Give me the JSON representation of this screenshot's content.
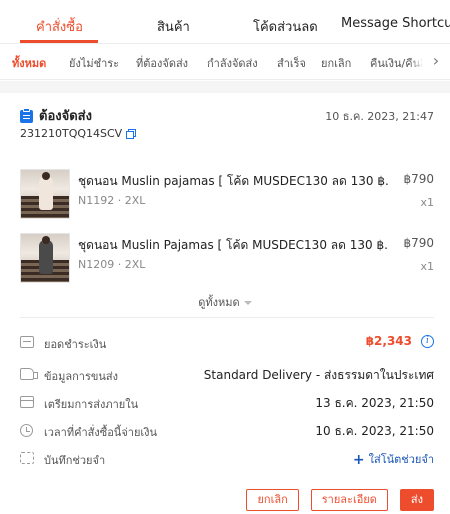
{
  "top_tabs": [
    {
      "label": "คำสั่งซื้อ",
      "active": true
    },
    {
      "label": "สินค้า",
      "active": false
    },
    {
      "label": "โค้ดส่วนลด",
      "active": false
    },
    {
      "label": "Message Shortcut",
      "active": false
    }
  ],
  "sub_tabs": [
    {
      "label": "ทั้งหมด",
      "active": true
    },
    {
      "label": "ยังไม่ชำระ",
      "active": false
    },
    {
      "label": "ที่ต้องจัดส่ง",
      "active": false
    },
    {
      "label": "กำลังจัดส่ง",
      "active": false
    },
    {
      "label": "สำเร็จ",
      "active": false
    },
    {
      "label": "ยกเลิก",
      "active": false
    },
    {
      "label": "คืนเงิน/คืนสินค้า",
      "active": false
    }
  ],
  "sub_tabs_arrow": "›",
  "order": {
    "status": "ต้องจัดส่ง",
    "date": "10 ธ.ค. 2023, 21:47",
    "order_id": "231210TQQ14SCV",
    "products": [
      {
        "name": "ชุดนอน Muslin pajamas [ โค้ด MUSDEC130 ลด 130 ฿.",
        "variant": "N1192 · 2XL",
        "price": "฿790",
        "qty": "x1"
      },
      {
        "name": "ชุดนอน Muslin Pajamas [ โค้ด MUSDEC130 ลด 130 ฿.",
        "variant": "N1209 · 2XL",
        "price": "฿790",
        "qty": "x1"
      }
    ],
    "see_all": "ดูทั้งหมด",
    "info": {
      "total_label": "ยอดชำระเงิน",
      "total_value": "฿2,343",
      "total_info_icon": "i",
      "shipping_label": "ข้อมูลการขนส่ง",
      "shipping_value": "Standard Delivery - ส่งธรรมดาในประเทศ",
      "prepare_label": "เตรียมการส่งภายใน",
      "prepare_value": "13 ธ.ค. 2023, 21:50",
      "paid_label": "เวลาที่คำสั่งซื้อนี้จ่ายเงิน",
      "paid_value": "10 ธ.ค. 2023, 21:50",
      "note_label": "บันทึกช่วยจำ",
      "note_action_plus": "+",
      "note_action": "ใส่โน้ตช่วยจำ"
    },
    "buttons": {
      "cancel": "ยกเลิก",
      "details": "รายละเอียด",
      "ship": "ส่ง"
    }
  },
  "colors": {
    "accent": "#ee4d2d",
    "link": "#1a73e8",
    "note_link": "#1a56b8"
  }
}
